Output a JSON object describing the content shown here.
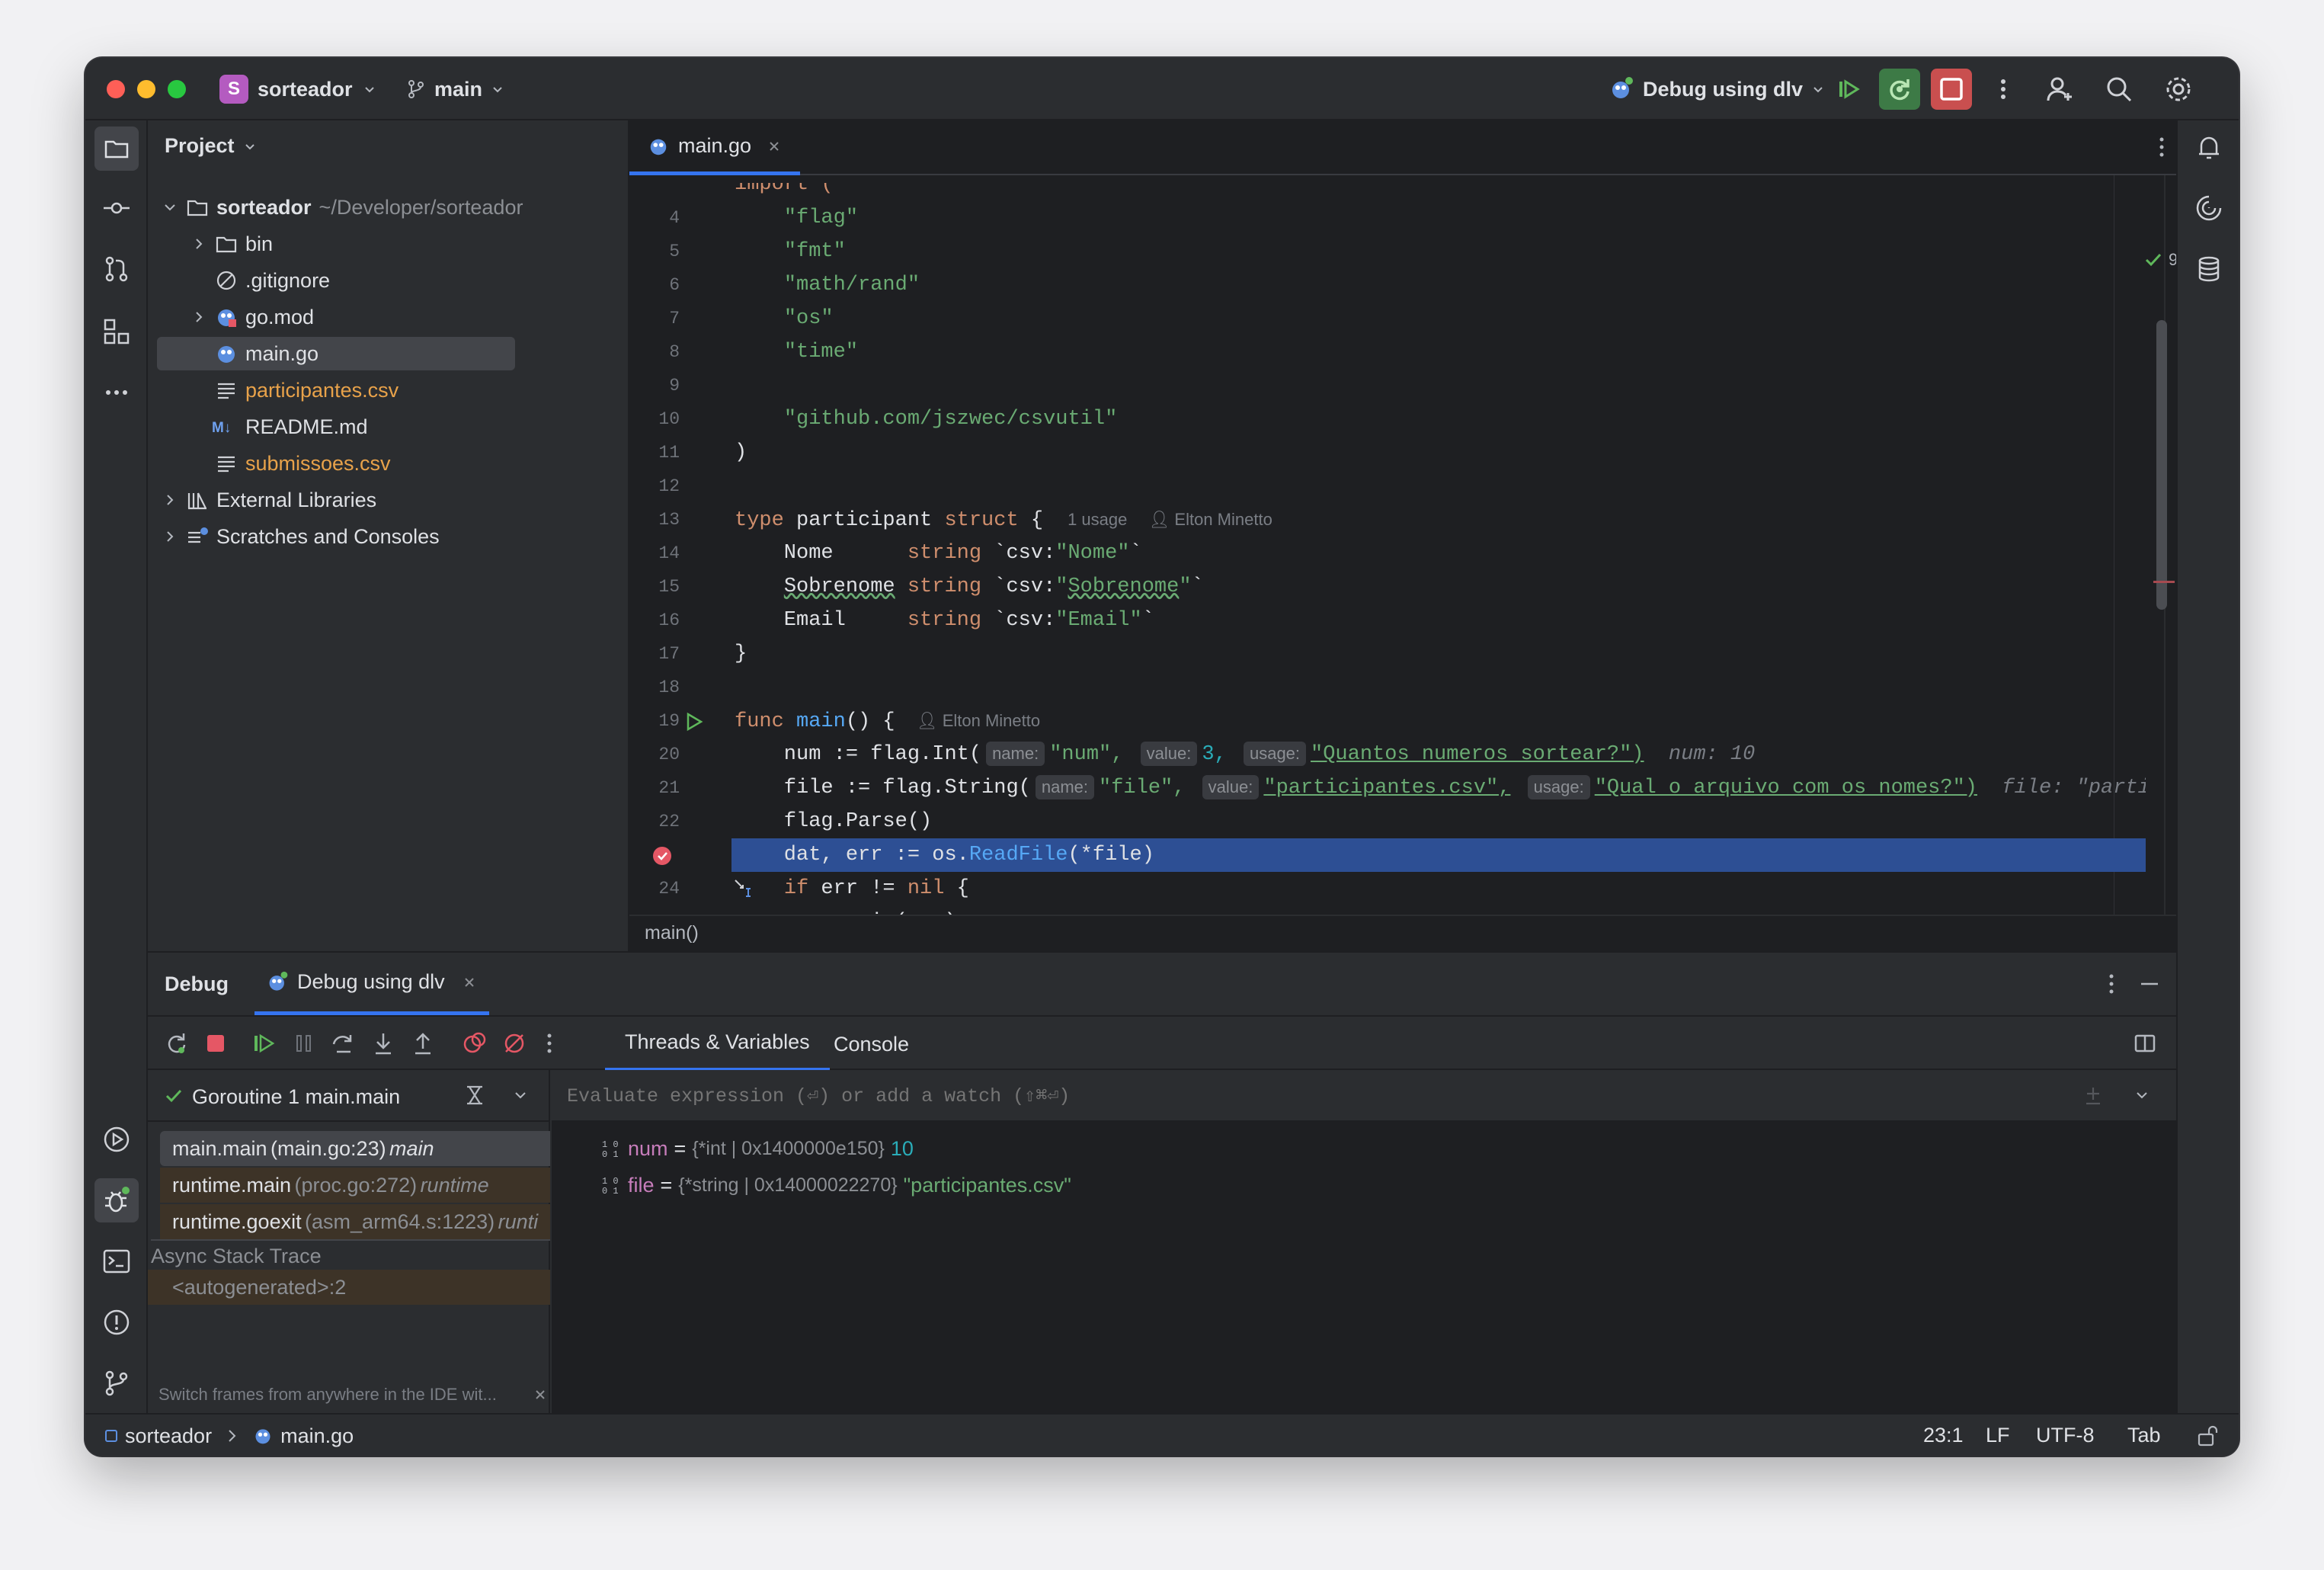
{
  "titlebar": {
    "project_letter": "S",
    "project_name": "sorteador",
    "branch": "main",
    "run_config": "Debug using dlv"
  },
  "project_panel": {
    "title": "Project",
    "root": {
      "name": "sorteador",
      "path": "~/Developer/sorteador"
    },
    "items": [
      {
        "name": "bin",
        "type": "folder"
      },
      {
        "name": ".gitignore",
        "type": "ignore"
      },
      {
        "name": "go.mod",
        "type": "gomod"
      },
      {
        "name": "main.go",
        "type": "go"
      },
      {
        "name": "participantes.csv",
        "type": "csv"
      },
      {
        "name": "README.md",
        "type": "md"
      },
      {
        "name": "submissoes.csv",
        "type": "csv"
      }
    ],
    "external_libraries": "External Libraries",
    "scratches": "Scratches and Consoles"
  },
  "editor": {
    "tab": "main.go",
    "problems_count": "9",
    "breadcrumb": "main()",
    "lines": [
      {
        "n": "4",
        "text": "    \"flag\""
      },
      {
        "n": "5",
        "text": "    \"fmt\""
      },
      {
        "n": "6",
        "text": "    \"math/rand\""
      },
      {
        "n": "7",
        "text": "    \"os\""
      },
      {
        "n": "8",
        "text": "    \"time\""
      },
      {
        "n": "9",
        "text": ""
      },
      {
        "n": "10",
        "text": "    \"github.com/jszwec/csvutil\""
      },
      {
        "n": "11",
        "text": ")"
      },
      {
        "n": "12",
        "text": ""
      },
      {
        "n": "13",
        "text": "type participant struct {"
      },
      {
        "n": "14",
        "text": "    Nome      string `csv:\"Nome\"`"
      },
      {
        "n": "15",
        "text": "    Sobrenome string `csv:\"Sobrenome\"`"
      },
      {
        "n": "16",
        "text": "    Email     string `csv:\"Email\"`"
      },
      {
        "n": "17",
        "text": "}"
      },
      {
        "n": "18",
        "text": ""
      },
      {
        "n": "19",
        "text": "func main() {"
      },
      {
        "n": "20",
        "text": "    num := flag.Int("
      },
      {
        "n": "21",
        "text": "    file := flag.String("
      },
      {
        "n": "22",
        "text": "    flag.Parse()"
      },
      {
        "n": "23",
        "text": "    dat, err := os.ReadFile(*file)"
      },
      {
        "n": "24",
        "text": "    if err != nil {"
      }
    ],
    "author_hint": "Elton Minetto",
    "usage_hint": "1 usage",
    "line20": {
      "name_param": "name:",
      "name_val": "\"num\",",
      "value_param": "value:",
      "value_val": "3,",
      "usage_param": "usage:",
      "usage_val": "\"Quantos numeros sortear?\")",
      "inline_value": "num: 10"
    },
    "line21": {
      "name_param": "name:",
      "name_val": "\"file\",",
      "value_param": "value:",
      "value_val": "\"participantes.csv\",",
      "usage_param": "usage:",
      "usage_val": "\"Qual o arquivo com os nomes?\")",
      "inline_value": "file: \"participantes.cs"
    }
  },
  "debug": {
    "title": "Debug",
    "session_tab": "Debug using dlv",
    "tabs": [
      "Threads & Variables",
      "Console"
    ],
    "goroutine": "Goroutine 1 main.main",
    "frames": [
      {
        "func": "main.main",
        "loc": "(main.go:23)",
        "pkg": "main"
      },
      {
        "func": "runtime.main",
        "loc": "(proc.go:272)",
        "pkg": "runtime"
      },
      {
        "func": "runtime.goexit",
        "loc": "(asm_arm64.s:1223)",
        "pkg": "runti"
      }
    ],
    "async_label": "Async Stack Trace",
    "async_frame": "<autogenerated>:2",
    "hint": "Switch frames from anywhere in the IDE wit...",
    "eval_placeholder": "Evaluate expression (⏎) or add a watch (⇧⌘⏎)",
    "variables": [
      {
        "name": "num",
        "type": "{*int | 0x1400000e150}",
        "value": "10"
      },
      {
        "name": "file",
        "type": "{*string | 0x14000022270}",
        "value": "\"participantes.csv\""
      }
    ]
  },
  "statusbar": {
    "project": "sorteador",
    "file": "main.go",
    "position": "23:1",
    "line_sep": "LF",
    "encoding": "UTF-8",
    "indent": "Tab"
  },
  "colors": {
    "accent": "#3574f0",
    "exec_line": "#2d4f94",
    "breakpoint": "#e55765",
    "string": "#6aab73",
    "keyword": "#cf8e6d"
  }
}
